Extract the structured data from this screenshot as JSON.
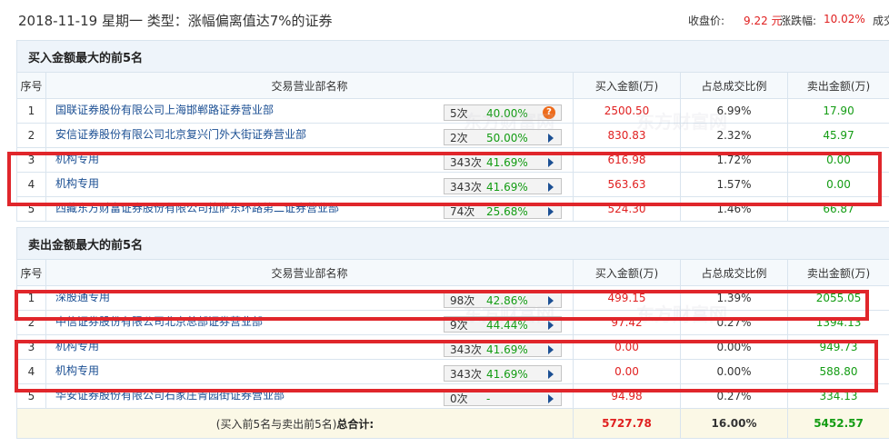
{
  "header": {
    "title": "2018-11-19 星期一  类型：涨幅偏离值达7%的证券",
    "close_label": "收盘价:",
    "close_value": "9.22 元",
    "change_label": "涨跌幅:",
    "change_value": "10.02%",
    "truncated": "成交"
  },
  "buy": {
    "section_title": "买入金额最大的前5名",
    "columns": [
      "序号",
      "交易营业部名称",
      "买入金额(万)",
      "占总成交比例",
      "卖出金额(万)"
    ],
    "rows": [
      {
        "seq": "1",
        "name": "国联证券股份有限公司上海邯郸路证券营业部",
        "times": "5次",
        "pct": "40.00%",
        "buy": "2500.50",
        "ratio": "6.99%",
        "sell": "17.90",
        "icon": "question"
      },
      {
        "seq": "2",
        "name": "安信证券股份有限公司北京复兴门外大街证券营业部",
        "times": "2次",
        "pct": "50.00%",
        "buy": "830.83",
        "ratio": "2.32%",
        "sell": "45.97",
        "icon": "arrow"
      },
      {
        "seq": "3",
        "name": "机构专用",
        "times": "343次",
        "pct": "41.69%",
        "buy": "616.98",
        "ratio": "1.72%",
        "sell": "0.00",
        "icon": "arrow"
      },
      {
        "seq": "4",
        "name": "机构专用",
        "times": "343次",
        "pct": "41.69%",
        "buy": "563.63",
        "ratio": "1.57%",
        "sell": "0.00",
        "icon": "arrow"
      },
      {
        "seq": "5",
        "name": "西藏东方财富证券股份有限公司拉萨东环路第二证券营业部",
        "times": "74次",
        "pct": "25.68%",
        "buy": "524.30",
        "ratio": "1.46%",
        "sell": "66.87",
        "icon": "arrow"
      }
    ]
  },
  "sell": {
    "section_title": "卖出金额最大的前5名",
    "columns": [
      "序号",
      "交易营业部名称",
      "买入金额(万)",
      "占总成交比例",
      "卖出金额(万)"
    ],
    "rows": [
      {
        "seq": "1",
        "name": "深股通专用",
        "times": "98次",
        "pct": "42.86%",
        "buy": "499.15",
        "ratio": "1.39%",
        "sell": "2055.05",
        "icon": "arrow"
      },
      {
        "seq": "2",
        "name": "中信证券股份有限公司北京总部证券营业部",
        "times": "9次",
        "pct": "44.44%",
        "buy": "97.42",
        "ratio": "0.27%",
        "sell": "1394.13",
        "icon": "arrow"
      },
      {
        "seq": "3",
        "name": "机构专用",
        "times": "343次",
        "pct": "41.69%",
        "buy": "0.00",
        "ratio": "0.00%",
        "sell": "949.73",
        "icon": "arrow"
      },
      {
        "seq": "4",
        "name": "机构专用",
        "times": "343次",
        "pct": "41.69%",
        "buy": "0.00",
        "ratio": "0.00%",
        "sell": "588.80",
        "icon": "arrow"
      },
      {
        "seq": "5",
        "name": "华安证券股份有限公司石家庄青园街证券营业部",
        "times": "0次",
        "pct": "-",
        "buy": "94.98",
        "ratio": "0.27%",
        "sell": "334.13",
        "icon": "arrow"
      }
    ]
  },
  "total": {
    "label_prefix": "(买入前5名与卖出前5名)",
    "label_bold": "总合计:",
    "buy": "5727.78",
    "ratio": "16.00%",
    "sell": "5452.57"
  },
  "watermark": "东方财富网",
  "colors": {
    "highlight": "#e0262b",
    "rise": "#e02020",
    "fall": "#139c13",
    "link": "#1b4f93"
  }
}
